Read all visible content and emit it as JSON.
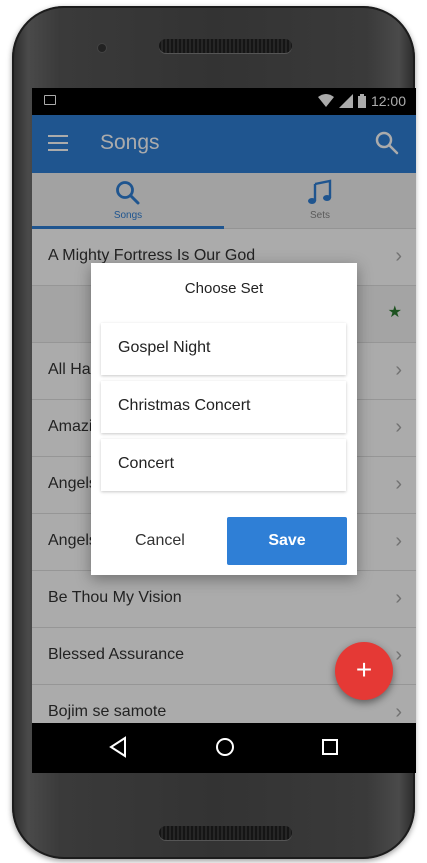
{
  "status_bar": {
    "time": "12:00"
  },
  "app_bar": {
    "title": "Songs"
  },
  "tabs": [
    {
      "label": "Songs",
      "icon": "search-icon",
      "selected": true
    },
    {
      "label": "Sets",
      "icon": "music-note-icon",
      "selected": false
    }
  ],
  "songs": [
    {
      "title": "A Mighty Fortress Is Our God"
    },
    {
      "title": "All Hail the Power of Jesus' Name"
    },
    {
      "title": "Amazing Grace"
    },
    {
      "title": "Angels We Have Heard on High"
    },
    {
      "title": "Angels from the Realms of Glory"
    },
    {
      "title": "Be Thou My Vision"
    },
    {
      "title": "Blessed Assurance"
    },
    {
      "title": "Bojim se samote"
    }
  ],
  "dialog": {
    "title": "Choose Set",
    "options": [
      "Gospel Night",
      "Christmas Concert",
      "Concert"
    ],
    "cancel_label": "Cancel",
    "save_label": "Save"
  },
  "fab": {
    "label": "+"
  },
  "colors": {
    "primary": "#2f7fd6",
    "fab": "#e53935",
    "favorite": "#2e7d32"
  }
}
